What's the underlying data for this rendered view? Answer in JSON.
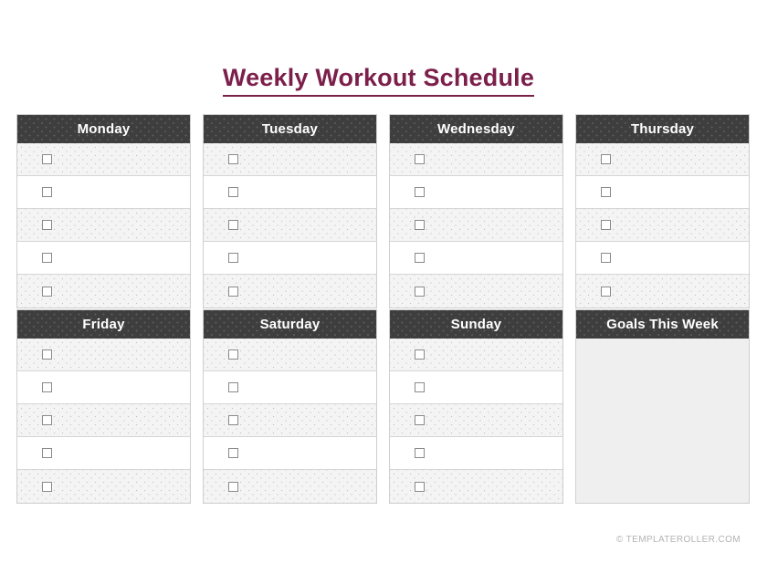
{
  "document": {
    "title": "Weekly Workout Schedule",
    "accent_color": "#7B1F4B",
    "header_bg_color": "#3E3E3E",
    "shaded_row_color": "#F4F4F4",
    "goals_panel_color": "#EFEFEF"
  },
  "blocks": [
    {
      "id": "monday",
      "header": "Monday",
      "type": "day",
      "rows": [
        {
          "checkbox": "unchecked",
          "text": ""
        },
        {
          "checkbox": "unchecked",
          "text": ""
        },
        {
          "checkbox": "unchecked",
          "text": ""
        },
        {
          "checkbox": "unchecked",
          "text": ""
        },
        {
          "checkbox": "unchecked",
          "text": ""
        }
      ]
    },
    {
      "id": "tuesday",
      "header": "Tuesday",
      "type": "day",
      "rows": [
        {
          "checkbox": "unchecked",
          "text": ""
        },
        {
          "checkbox": "unchecked",
          "text": ""
        },
        {
          "checkbox": "unchecked",
          "text": ""
        },
        {
          "checkbox": "unchecked",
          "text": ""
        },
        {
          "checkbox": "unchecked",
          "text": ""
        }
      ]
    },
    {
      "id": "wednesday",
      "header": "Wednesday",
      "type": "day",
      "rows": [
        {
          "checkbox": "unchecked",
          "text": ""
        },
        {
          "checkbox": "unchecked",
          "text": ""
        },
        {
          "checkbox": "unchecked",
          "text": ""
        },
        {
          "checkbox": "unchecked",
          "text": ""
        },
        {
          "checkbox": "unchecked",
          "text": ""
        }
      ]
    },
    {
      "id": "thursday",
      "header": "Thursday",
      "type": "day",
      "rows": [
        {
          "checkbox": "unchecked",
          "text": ""
        },
        {
          "checkbox": "unchecked",
          "text": ""
        },
        {
          "checkbox": "unchecked",
          "text": ""
        },
        {
          "checkbox": "unchecked",
          "text": ""
        },
        {
          "checkbox": "unchecked",
          "text": ""
        }
      ]
    },
    {
      "id": "friday",
      "header": "Friday",
      "type": "day",
      "rows": [
        {
          "checkbox": "unchecked",
          "text": ""
        },
        {
          "checkbox": "unchecked",
          "text": ""
        },
        {
          "checkbox": "unchecked",
          "text": ""
        },
        {
          "checkbox": "unchecked",
          "text": ""
        },
        {
          "checkbox": "unchecked",
          "text": ""
        }
      ]
    },
    {
      "id": "saturday",
      "header": "Saturday",
      "type": "day",
      "rows": [
        {
          "checkbox": "unchecked",
          "text": ""
        },
        {
          "checkbox": "unchecked",
          "text": ""
        },
        {
          "checkbox": "unchecked",
          "text": ""
        },
        {
          "checkbox": "unchecked",
          "text": ""
        },
        {
          "checkbox": "unchecked",
          "text": ""
        }
      ]
    },
    {
      "id": "sunday",
      "header": "Sunday",
      "type": "day",
      "rows": [
        {
          "checkbox": "unchecked",
          "text": ""
        },
        {
          "checkbox": "unchecked",
          "text": ""
        },
        {
          "checkbox": "unchecked",
          "text": ""
        },
        {
          "checkbox": "unchecked",
          "text": ""
        },
        {
          "checkbox": "unchecked",
          "text": ""
        }
      ]
    },
    {
      "id": "goals",
      "header": "Goals This Week",
      "type": "notes",
      "value": "",
      "rows": []
    }
  ],
  "footer": {
    "credit": "© TEMPLATEROLLER.COM"
  }
}
